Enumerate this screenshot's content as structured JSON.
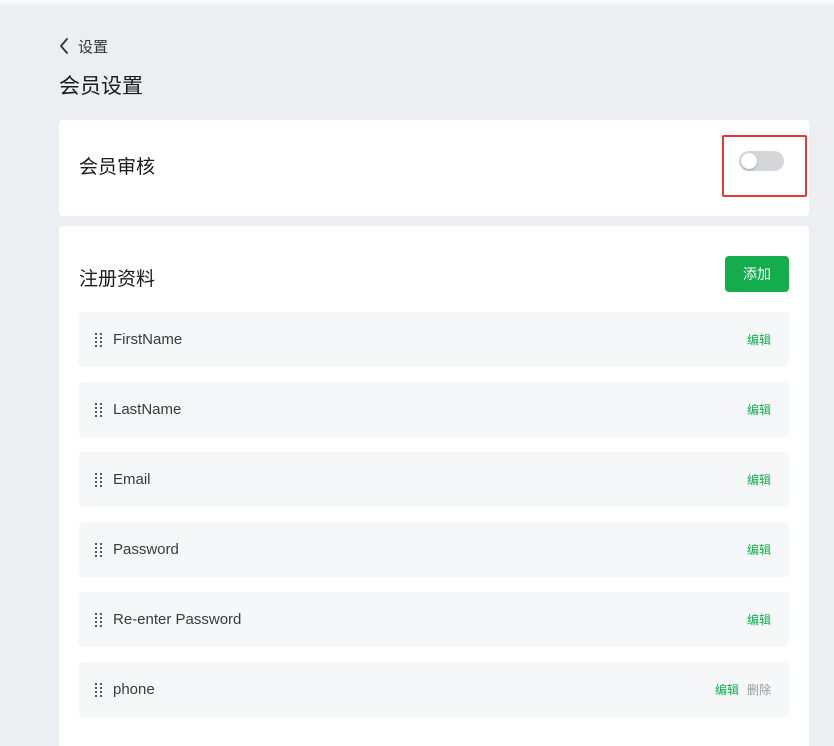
{
  "header": {
    "back_label": "设置",
    "page_title": "会员设置"
  },
  "review": {
    "label": "会员审核",
    "toggle_on": false
  },
  "fields_section": {
    "title": "注册资料",
    "add_label": "添加",
    "rows": [
      {
        "name": "FirstName",
        "edit": "编辑"
      },
      {
        "name": "LastName",
        "edit": "编辑"
      },
      {
        "name": "Email",
        "edit": "编辑"
      },
      {
        "name": "Password",
        "edit": "编辑"
      },
      {
        "name": "Re-enter Password",
        "edit": "编辑"
      },
      {
        "name": "phone",
        "edit": "编辑",
        "delete": "删除"
      }
    ]
  },
  "colors": {
    "accent": "#13ad4e",
    "highlight": "#e53935",
    "background": "#eceef1"
  },
  "icons": {
    "back": "chevron-left-icon",
    "drag": "drag-handle-icon"
  }
}
